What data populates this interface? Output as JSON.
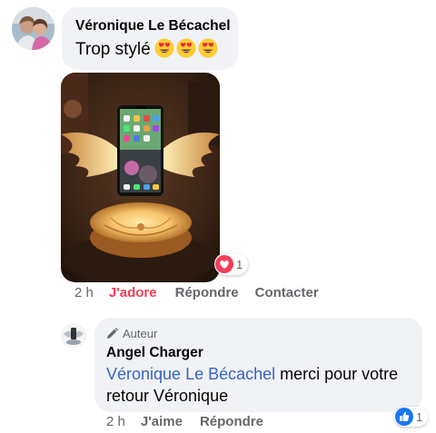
{
  "comment": {
    "author": "Véronique Le Bécachel",
    "text": "Trop stylé",
    "emojis": [
      "heart-eyes-emoji",
      "heart-eyes-emoji",
      "heart-eyes-emoji"
    ],
    "reaction": {
      "icon": "love-reaction-icon",
      "count": "1"
    },
    "actions": {
      "time": "2 h",
      "react": "J'adore",
      "reply": "Répondre",
      "contact": "Contacter"
    },
    "colors": {
      "react_active": "#f33e58"
    }
  },
  "reply": {
    "badge": "Auteur",
    "author": "Angel Charger",
    "mention": "Véronique Le Bécachel",
    "text": " merci pour votre retour Véronique",
    "reaction": {
      "icon": "like-reaction-icon",
      "count": "1"
    },
    "actions": {
      "time": "2 h",
      "react": "J'aime",
      "reply": "Répondre"
    },
    "colors": {
      "mention": "#3863c0",
      "like": "#1877f2"
    }
  }
}
